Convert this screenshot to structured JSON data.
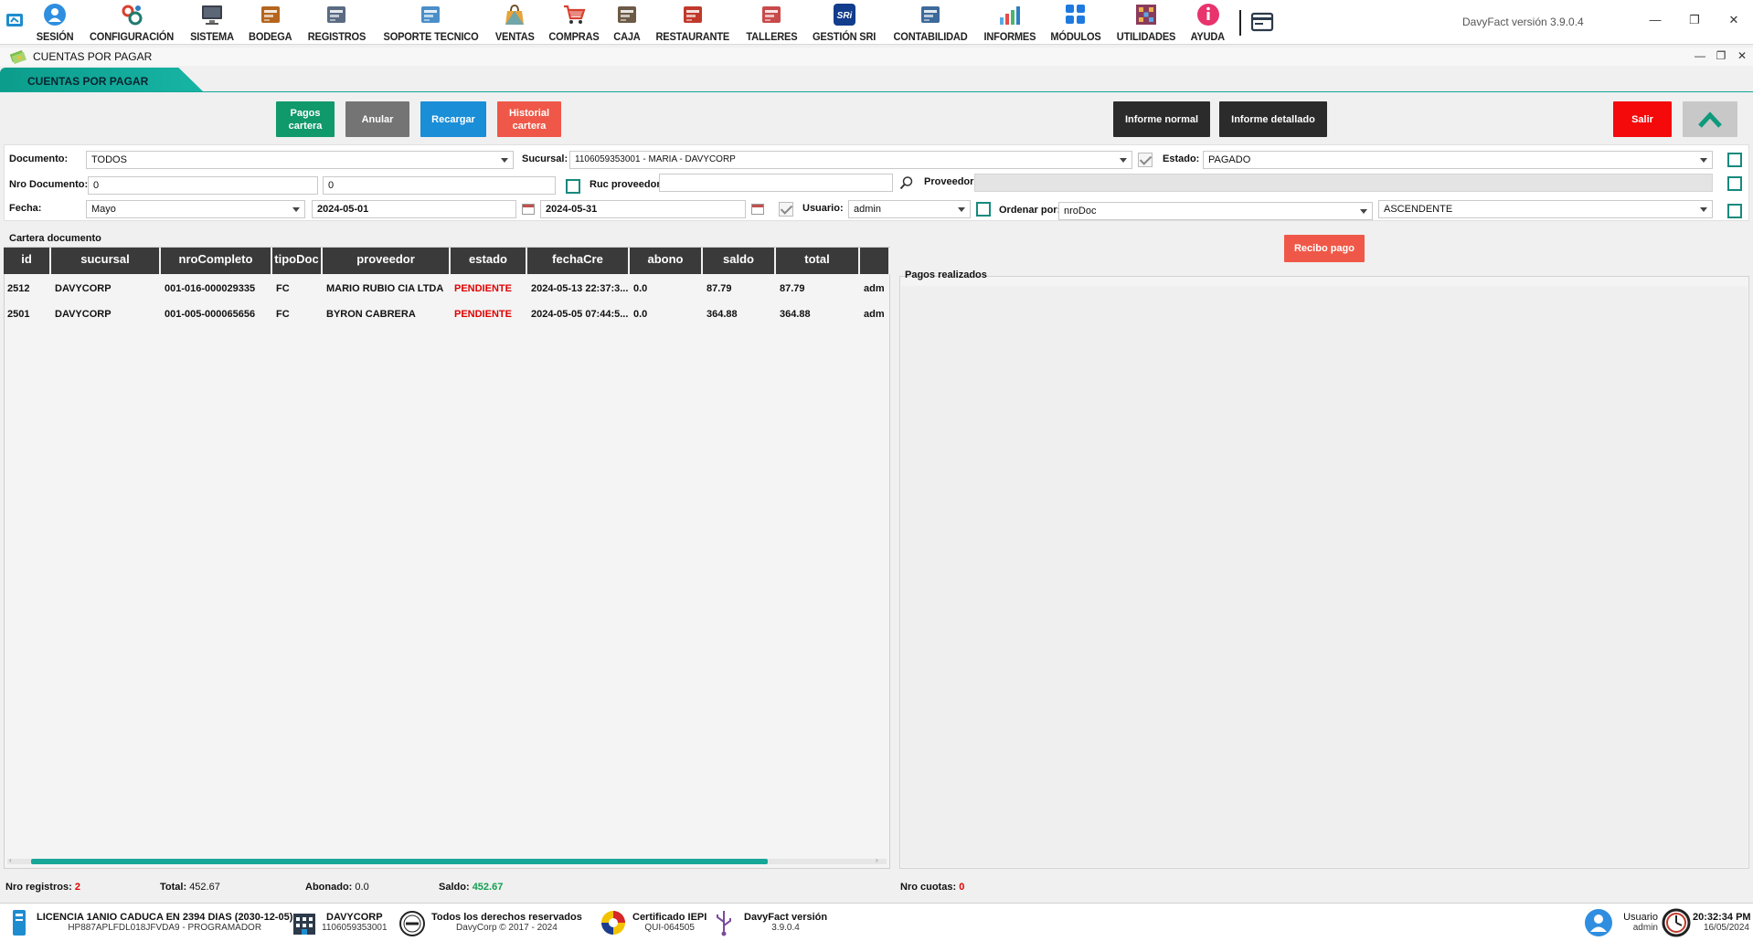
{
  "topbar": {
    "menu": [
      {
        "label": "SESIÓN",
        "icon": "user-circle-icon",
        "color": "#2f8ee0"
      },
      {
        "label": "CONFIGURACIÓN",
        "icon": "gears-icon",
        "color": "#1e7b6e"
      },
      {
        "label": "SISTEMA",
        "icon": "monitor-icon",
        "color": "#3a3f4a"
      },
      {
        "label": "BODEGA",
        "icon": "warehouse-icon",
        "color": "#b5651d"
      },
      {
        "label": "REGISTROS",
        "icon": "contacts-icon",
        "color": "#5a6b82"
      },
      {
        "label": "SOPORTE TECNICO",
        "icon": "support-icon",
        "color": "#4a8fc9"
      },
      {
        "label": "VENTAS",
        "icon": "shopping-bag-icon",
        "color": "#e8a33a"
      },
      {
        "label": "COMPRAS",
        "icon": "cart-icon",
        "color": "#d9402e"
      },
      {
        "label": "CAJA",
        "icon": "cash-register-icon",
        "color": "#6b5a45"
      },
      {
        "label": "RESTAURANTE",
        "icon": "restaurant-icon",
        "color": "#c0392b"
      },
      {
        "label": "TALLERES",
        "icon": "workshop-icon",
        "color": "#c94a4a"
      },
      {
        "label": "GESTIÓN SRI",
        "icon": "sri-logo-icon",
        "color": "#123c8c",
        "text": "SRi"
      },
      {
        "label": "CONTABILIDAD",
        "icon": "accounting-icon",
        "color": "#3d6a9a"
      },
      {
        "label": "INFORMES",
        "icon": "bar-chart-icon",
        "color": "#2d7fc1"
      },
      {
        "label": "MÓDULOS",
        "icon": "modules-icon",
        "color": "#1f7ae0"
      },
      {
        "label": "UTILIDADES",
        "icon": "tools-grid-icon",
        "color": "#8a3b5c"
      },
      {
        "label": "AYUDA",
        "icon": "info-icon",
        "color": "#e8336d"
      }
    ],
    "version": "DavyFact versión 3.9.0.4"
  },
  "window": {
    "title": "CUENTAS POR PAGAR",
    "tab": "CUENTAS POR PAGAR"
  },
  "buttons": {
    "pagos_cartera": "Pagos cartera",
    "anular": "Anular",
    "recargar": "Recargar",
    "historial_cartera": "Historial cartera",
    "informe_normal": "Informe normal",
    "informe_detallado": "Informe detallado",
    "salir": "Salir",
    "recibo_pago": "Recibo pago"
  },
  "colors": {
    "green": "#10996a",
    "gray": "#747474",
    "blue": "#1a8ed6",
    "coral": "#ef5848",
    "dark": "#2b2b2b",
    "red": "#f40a0a",
    "teal": "#17a698"
  },
  "filters": {
    "documento_label": "Documento:",
    "documento": "TODOS",
    "sucursal_label": "Sucursal:",
    "sucursal": "1106059353001 - MARIA - DAVYCORP",
    "estado_label": "Estado:",
    "estado": "PAGADO",
    "nro_documento_label": "Nro Documento:",
    "nro_desde": "0",
    "nro_hasta": "0",
    "ruc_label": "Ruc proveedor:",
    "ruc": "",
    "proveedor_label": "Proveedor:",
    "proveedor": "",
    "fecha_label": "Fecha:",
    "mes": "Mayo",
    "fecha_desde": "2024-05-01",
    "fecha_hasta": "2024-05-31",
    "usuario_label": "Usuario:",
    "usuario": "admin",
    "ordenar_label": "Ordenar por:",
    "ordenar": "nroDoc",
    "orden": "ASCENDENTE"
  },
  "cartera": {
    "title": "Cartera documento",
    "columns": [
      "id",
      "sucursal",
      "nroCompleto",
      "tipoDoc",
      "proveedor",
      "estado",
      "fechaCre",
      "abono",
      "saldo",
      "total",
      ""
    ],
    "rows": [
      [
        "2512",
        "DAVYCORP",
        "001-016-000029335",
        "FC",
        "MARIO RUBIO CIA LTDA",
        "PENDIENTE",
        "2024-05-13 22:37:3...",
        "0.0",
        "87.79",
        "87.79",
        "adm"
      ],
      [
        "2501",
        "DAVYCORP",
        "001-005-000065656",
        "FC",
        "BYRON CABRERA",
        "PENDIENTE",
        "2024-05-05 07:44:5...",
        "0.0",
        "364.88",
        "364.88",
        "adm"
      ]
    ]
  },
  "pagos": {
    "title": "Pagos realizados"
  },
  "summary": {
    "nro_registros_label": "Nro registros:",
    "nro_registros": "2",
    "total_label": "Total:",
    "total": "452.67",
    "abonado_label": "Abonado:",
    "abonado": "0.0",
    "saldo_label": "Saldo:",
    "saldo": "452.67",
    "nro_cuotas_label": "Nro cuotas:",
    "nro_cuotas": "0"
  },
  "status": {
    "licencia_1": "LICENCIA 1ANIO CADUCA EN 2394 DIAS (2030-12-05)",
    "licencia_2": "HP887APLFDL018JFVDA9 - PROGRAMADOR",
    "empresa_1": "DAVYCORP",
    "empresa_2": "1106059353001",
    "derechos_1": "Todos los derechos reservados",
    "derechos_2": "DavyCorp © 2017 - 2024",
    "cert_1": "Certificado IEPI",
    "cert_2": "QUI-064505",
    "ver_1": "DavyFact versión",
    "ver_2": "3.9.0.4",
    "usuario_1": "Usuario",
    "usuario_2": "admin",
    "hora": "20:32:34 PM",
    "fecha": "16/05/2024"
  }
}
